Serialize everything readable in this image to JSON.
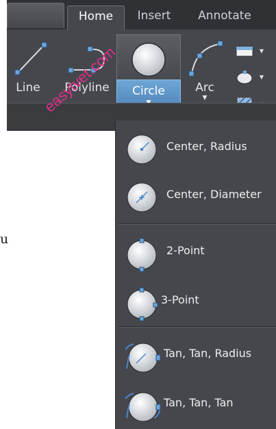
{
  "tabs": [
    "Home",
    "Insert",
    "Annotate"
  ],
  "active_tab": "Home",
  "tools": {
    "line": "Line",
    "polyline": "Polyline",
    "circle": "Circle",
    "arc": "Arc"
  },
  "circle_menu": [
    {
      "label": "Center, Radius",
      "icon": "circle-center-radius-icon"
    },
    {
      "label": "Center, Diameter",
      "icon": "circle-center-diameter-icon"
    },
    {
      "label": "2-Point",
      "icon": "circle-2-point-icon"
    },
    {
      "label": "3-Point",
      "icon": "circle-3-point-icon"
    },
    {
      "label": "Tan, Tan, Radius",
      "icon": "circle-tan-tan-radius-icon"
    },
    {
      "label": "Tan, Tan, Tan",
      "icon": "circle-tan-tan-tan-icon"
    }
  ],
  "stray_text": "u",
  "watermark": "easytvet.com",
  "colors": {
    "ribbon_bg": "#45474c",
    "active_button": "#4f86bf",
    "icon_blue": "#4a86c8"
  }
}
